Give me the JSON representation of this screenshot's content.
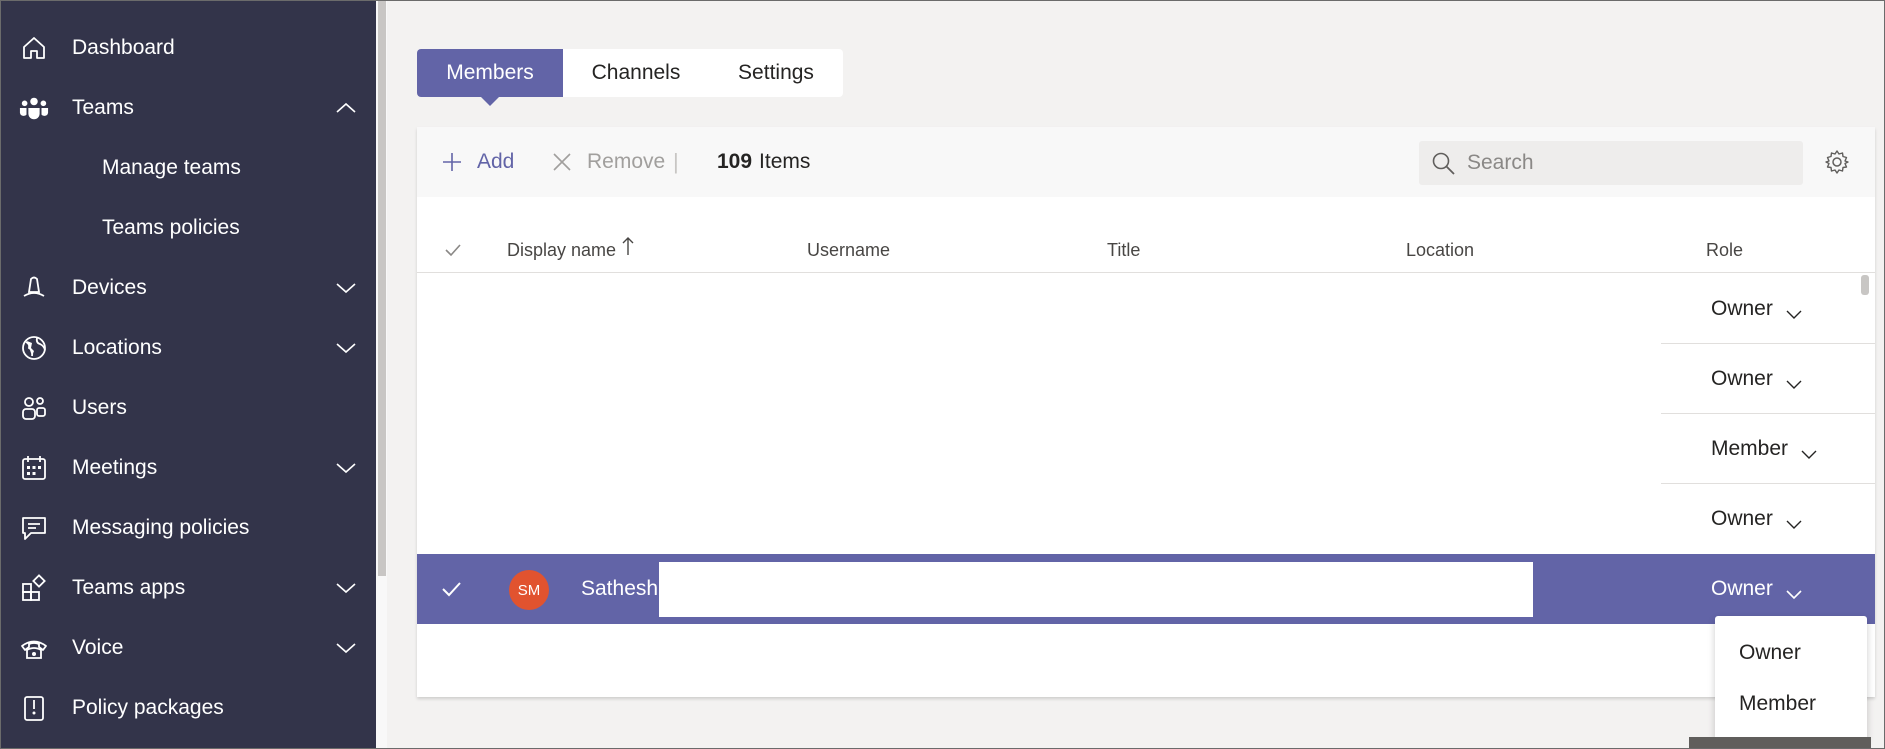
{
  "sidebar": {
    "items": [
      {
        "label": "Dashboard",
        "icon": "home-icon"
      },
      {
        "label": "Teams",
        "icon": "teams-icon",
        "expanded": true
      },
      {
        "label": "Manage teams"
      },
      {
        "label": "Teams policies"
      },
      {
        "label": "Devices",
        "icon": "devices-icon"
      },
      {
        "label": "Locations",
        "icon": "globe-icon"
      },
      {
        "label": "Users",
        "icon": "users-icon"
      },
      {
        "label": "Meetings",
        "icon": "calendar-icon"
      },
      {
        "label": "Messaging policies",
        "icon": "message-icon"
      },
      {
        "label": "Teams apps",
        "icon": "apps-icon"
      },
      {
        "label": "Voice",
        "icon": "phone-icon"
      },
      {
        "label": "Policy packages",
        "icon": "package-icon"
      }
    ]
  },
  "tabs": [
    "Members",
    "Channels",
    "Settings"
  ],
  "toolbar": {
    "add_label": "Add",
    "remove_label": "Remove",
    "separator": "|",
    "items_count": "109",
    "items_label": "Items",
    "search_placeholder": "Search"
  },
  "table": {
    "columns": [
      "Display name",
      "Username",
      "Title",
      "Location",
      "Role"
    ],
    "rows": [
      {
        "role": "Owner"
      },
      {
        "role": "Owner"
      },
      {
        "role": "Member"
      },
      {
        "role": "Owner"
      }
    ],
    "selected_row": {
      "initials": "SM",
      "name": "Sathesh",
      "role": "Owner"
    }
  },
  "role_menu": {
    "options": [
      "Owner",
      "Member"
    ]
  },
  "colors": {
    "sidebar": "#33344a",
    "accent": "#6264a7",
    "avatar": "#e1532f"
  }
}
